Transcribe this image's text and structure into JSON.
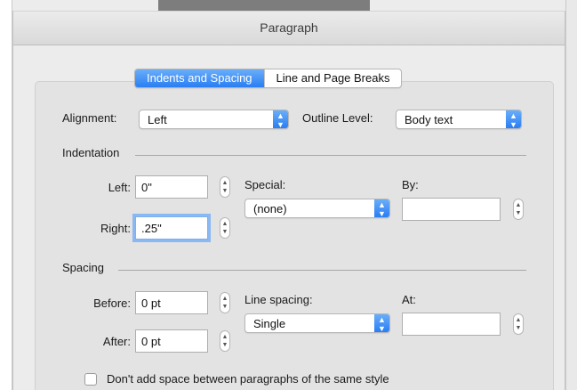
{
  "dialog": {
    "title": "Paragraph"
  },
  "tabs": [
    {
      "label": "Indents and Spacing",
      "active": true
    },
    {
      "label": "Line and Page Breaks",
      "active": false
    }
  ],
  "general": {
    "alignment_label": "Alignment:",
    "alignment_value": "Left",
    "outline_label": "Outline Level:",
    "outline_value": "Body text"
  },
  "indentation": {
    "title": "Indentation",
    "left_label": "Left:",
    "left_value": "0\"",
    "right_label": "Right:",
    "right_value": ".25\"",
    "special_label": "Special:",
    "special_value": "(none)",
    "by_label": "By:",
    "by_value": ""
  },
  "spacing": {
    "title": "Spacing",
    "before_label": "Before:",
    "before_value": "0 pt",
    "after_label": "After:",
    "after_value": "0 pt",
    "line_spacing_label": "Line spacing:",
    "line_spacing_value": "Single",
    "at_label": "At:",
    "at_value": ""
  },
  "options": {
    "dont_add_space_label": "Don't add space between paragraphs of the same style"
  },
  "colors": {
    "accent": "#2a7ef3",
    "accent_light": "#6aaef9",
    "focus_ring": "#8ab8f2"
  },
  "icons": {
    "popup_arrows": "up-down-chevron-icon",
    "stepper": "stepper-icon"
  }
}
